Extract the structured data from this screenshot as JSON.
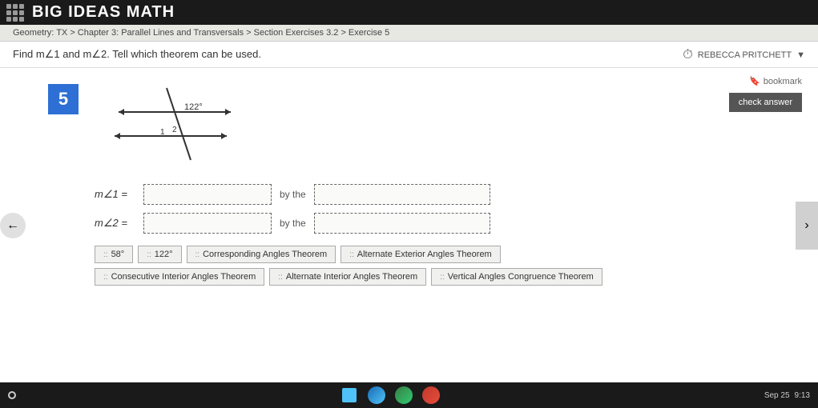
{
  "topbar": {
    "title": "BIG IDEAS MATH"
  },
  "breadcrumb": {
    "text": "Geometry: TX > Chapter 3: Parallel Lines and Transversals > Section Exercises 3.2 > Exercise 5"
  },
  "header": {
    "instruction": "Find m∠1 and m∠2. Tell which theorem can be used.",
    "user": "REBECCA PRITCHETT"
  },
  "problem": {
    "number": "5",
    "angle1_label": "m∠1 =",
    "angle2_label": "m∠2 =",
    "by_the_label": "by the",
    "angle_value_placeholder": "",
    "theorem_placeholder": ""
  },
  "diagram": {
    "angle_value": "122°",
    "angle1_pos": "1",
    "angle2_pos": "2"
  },
  "tiles": {
    "row1": [
      {
        "id": "tile-58",
        "label": "58°"
      },
      {
        "id": "tile-122",
        "label": "122°"
      },
      {
        "id": "tile-corresponding",
        "label": "Corresponding Angles Theorem"
      },
      {
        "id": "tile-alternate-exterior",
        "label": "Alternate Exterior Angles Theorem"
      }
    ],
    "row2": [
      {
        "id": "tile-consecutive",
        "label": "Consecutive Interior Angles Theorem"
      },
      {
        "id": "tile-alternate-interior",
        "label": "Alternate Interior Angles Theorem"
      },
      {
        "id": "tile-vertical",
        "label": "Vertical Angles Congruence Theorem"
      }
    ]
  },
  "buttons": {
    "check_answer": "check answer",
    "bookmark_label": "bookmark"
  },
  "taskbar": {
    "date": "Sep 25",
    "time": "9:13"
  },
  "section_label": "Section ("
}
